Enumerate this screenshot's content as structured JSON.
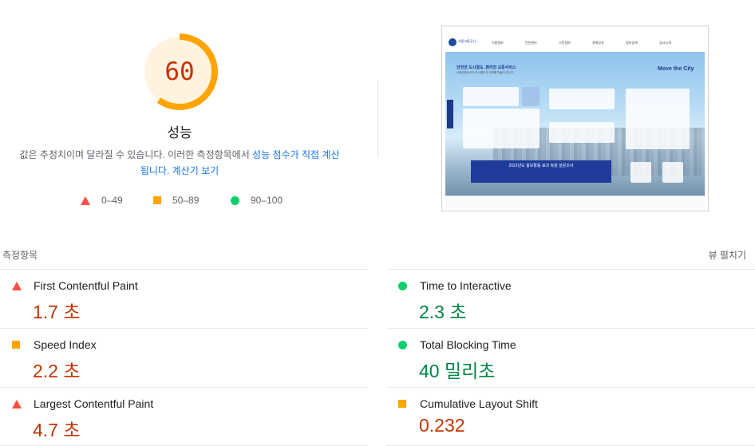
{
  "summary": {
    "score": "60",
    "score_fraction": 0.6,
    "title": "성능",
    "description_prefix": "값은 추정치이며 달라질 수 있습니다. 이러한 측정항목에서 ",
    "description_link": "성능 점수가 직접 계산됩니다",
    "description_mid": ". ",
    "calculator_link": "계산기 보기",
    "legend": [
      {
        "shape": "triangle",
        "label": "0–49"
      },
      {
        "shape": "square",
        "label": "50–89"
      },
      {
        "shape": "circle",
        "label": "90–100"
      }
    ],
    "colors": {
      "fail": "#ff4e42",
      "average": "#ffa400",
      "pass": "#0cce6b",
      "link": "#1a73e8"
    }
  },
  "screenshot": {
    "site_name": "서울교통공사",
    "nav": [
      "이용정보",
      "안전관리",
      "시민참여",
      "정책공유",
      "정보공개",
      "공사소개"
    ],
    "headline": "안전한 도시철도, 편리한 교통서비스",
    "subline": "서울교통공사가 도시철도의 미래를 만들어 갑니다.",
    "slogan": "Move the City",
    "banner": "2022년도 홍보활동 효과 측정 설문조사"
  },
  "metrics": {
    "title": "측정항목",
    "toggle": "뷰 펼치기",
    "items": [
      {
        "name": "First Contentful Paint",
        "value": "1.7 초",
        "rating": "fail"
      },
      {
        "name": "Time to Interactive",
        "value": "2.3 초",
        "rating": "pass"
      },
      {
        "name": "Speed Index",
        "value": "2.2 초",
        "rating": "average"
      },
      {
        "name": "Total Blocking Time",
        "value": "40 밀리초",
        "rating": "pass"
      },
      {
        "name": "Largest Contentful Paint",
        "value": "4.7 초",
        "rating": "fail"
      },
      {
        "name": "Cumulative Layout Shift",
        "value": "0.232",
        "rating": "average"
      }
    ]
  }
}
